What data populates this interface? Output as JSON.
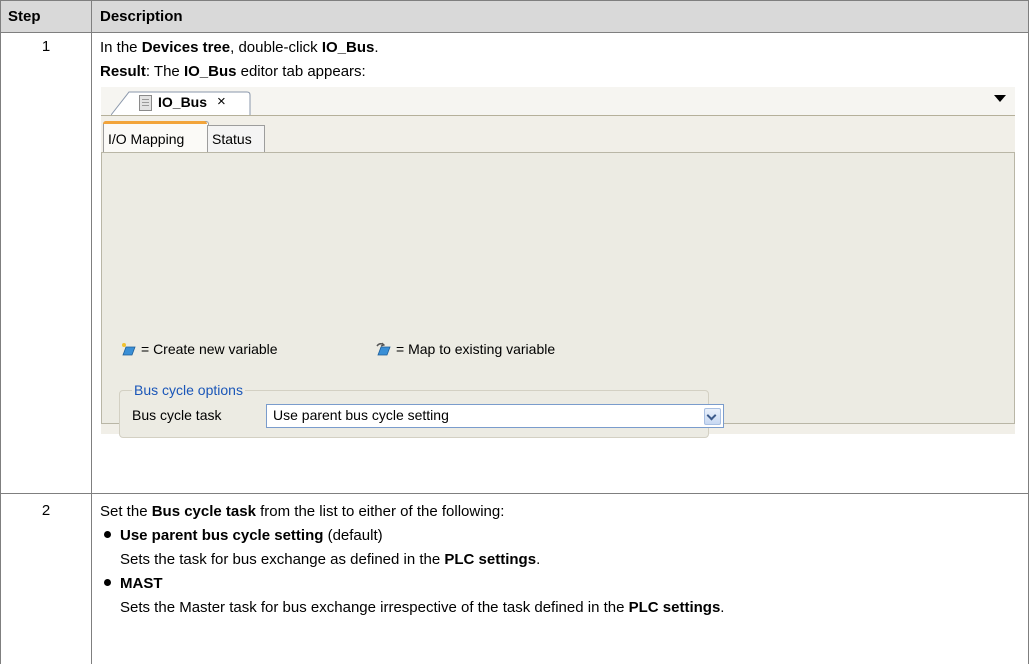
{
  "table": {
    "headers": {
      "step": "Step",
      "description": "Description"
    },
    "rows": [
      {
        "step": "1",
        "line1": {
          "pre": "In the ",
          "b1": "Devices tree",
          "mid": ", double-click ",
          "b2": "IO_Bus",
          "post": "."
        },
        "line2": {
          "b1": "Result",
          "pre": ": The ",
          "b2": "IO_Bus",
          "post": " editor tab appears:"
        }
      },
      {
        "step": "2",
        "line1": {
          "pre": "Set the ",
          "b1": "Bus cycle task",
          "post": " from the list to either of the following:"
        },
        "option1": {
          "name": "Use parent bus cycle setting",
          "suffix": " (default)",
          "desc_pre": "Sets the task for bus exchange as defined in the ",
          "desc_b": "PLC settings",
          "desc_post": "."
        },
        "option2": {
          "name": "MAST",
          "desc_pre": "Sets the Master task for bus exchange irrespective of the task defined in the ",
          "desc_b": "PLC settings",
          "desc_post": "."
        }
      }
    ]
  },
  "editor": {
    "tab_title": "IO_Bus",
    "close_glyph": "×",
    "subtabs": [
      "I/O Mapping",
      "Status"
    ],
    "legend": {
      "create": "= Create new variable",
      "map": "= Map to existing variable"
    },
    "group_title": "Bus cycle options",
    "bus_cycle_label": "Bus cycle task",
    "bus_cycle_value": "Use parent bus cycle setting"
  }
}
